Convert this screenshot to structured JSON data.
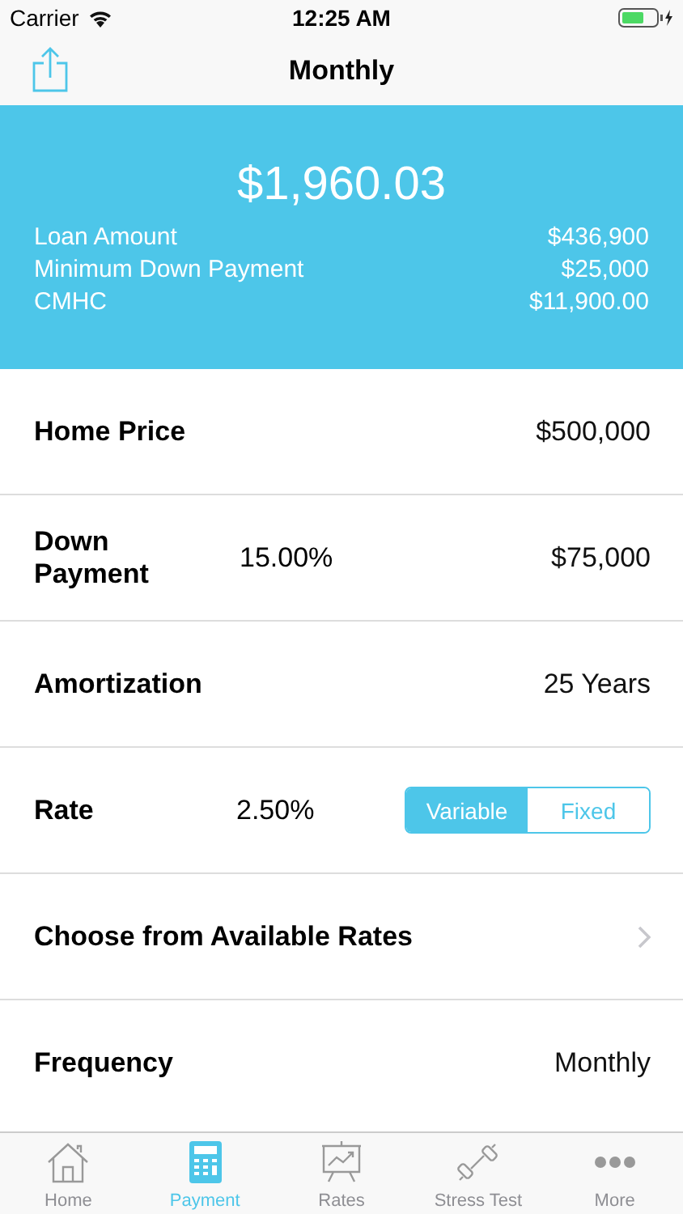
{
  "status_bar": {
    "carrier": "Carrier",
    "time": "12:25 AM"
  },
  "nav": {
    "title": "Monthly"
  },
  "summary": {
    "payment": "$1,960.03",
    "lines": [
      {
        "label": "Loan Amount",
        "value": "$436,900"
      },
      {
        "label": "Minimum Down Payment",
        "value": "$25,000"
      },
      {
        "label": "CMHC",
        "value": "$11,900.00"
      }
    ]
  },
  "rows": [
    {
      "kind": "value",
      "label": "Home Price",
      "value": "$500,000"
    },
    {
      "kind": "triple",
      "label": "Down Payment",
      "middle": "15.00%",
      "value": "$75,000"
    },
    {
      "kind": "value",
      "label": "Amortization",
      "value": "25 Years"
    },
    {
      "kind": "segment",
      "label": "Rate",
      "middle": "2.50%",
      "options": [
        {
          "label": "Variable",
          "selected": true
        },
        {
          "label": "Fixed",
          "selected": false
        }
      ]
    },
    {
      "kind": "link",
      "label": "Choose from Available Rates"
    },
    {
      "kind": "value",
      "label": "Frequency",
      "value": "Monthly"
    }
  ],
  "tabs": [
    {
      "kind": "home",
      "label": "Home",
      "selected": false
    },
    {
      "kind": "calculator",
      "label": "Payment",
      "selected": true
    },
    {
      "kind": "chart",
      "label": "Rates",
      "selected": false
    },
    {
      "kind": "dumbbell",
      "label": "Stress Test",
      "selected": false
    },
    {
      "kind": "more",
      "label": "More",
      "selected": false
    }
  ]
}
